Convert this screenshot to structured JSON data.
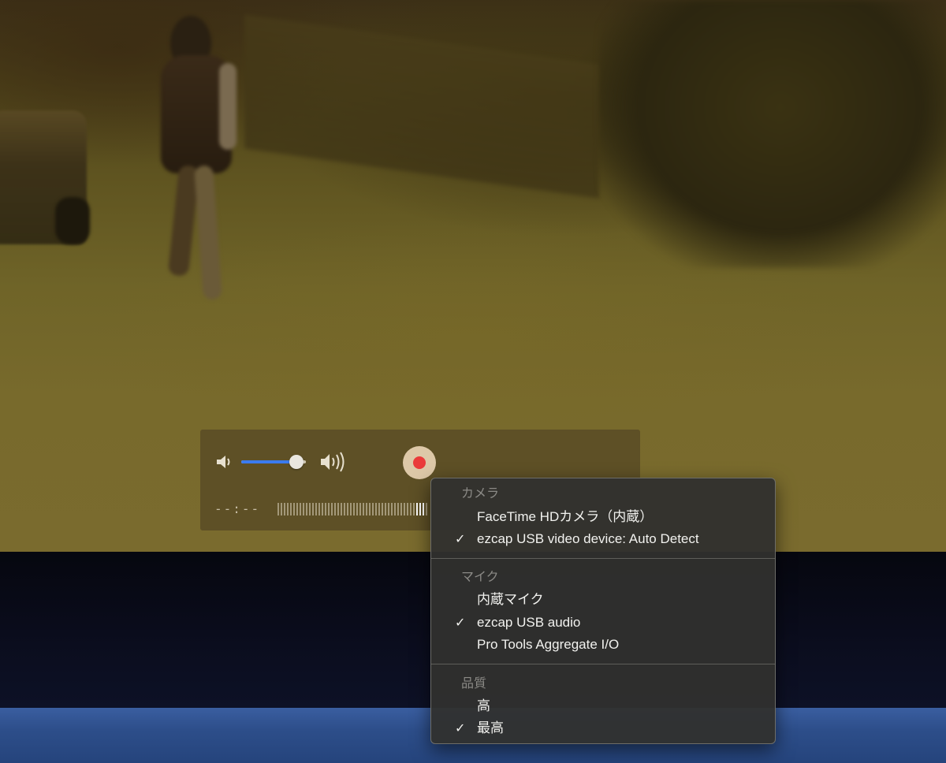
{
  "controls": {
    "volume_low_icon": "speaker-low-icon",
    "volume_high_icon": "speaker-high-icon",
    "volume_level": 0.85,
    "record_icon": "record-icon",
    "elapsed_time": "--:--"
  },
  "menu": {
    "camera": {
      "header": "カメラ",
      "items": [
        {
          "label": "FaceTime HDカメラ（内蔵）",
          "checked": false
        },
        {
          "label": "ezcap USB video device: Auto Detect",
          "checked": true
        }
      ]
    },
    "microphone": {
      "header": "マイク",
      "items": [
        {
          "label": "内蔵マイク",
          "checked": false
        },
        {
          "label": "ezcap USB audio",
          "checked": true
        },
        {
          "label": "Pro Tools Aggregate I/O",
          "checked": false
        }
      ]
    },
    "quality": {
      "header": "品質",
      "items": [
        {
          "label": "高",
          "checked": false
        },
        {
          "label": "最高",
          "checked": true
        }
      ]
    },
    "check_mark": "✓"
  }
}
